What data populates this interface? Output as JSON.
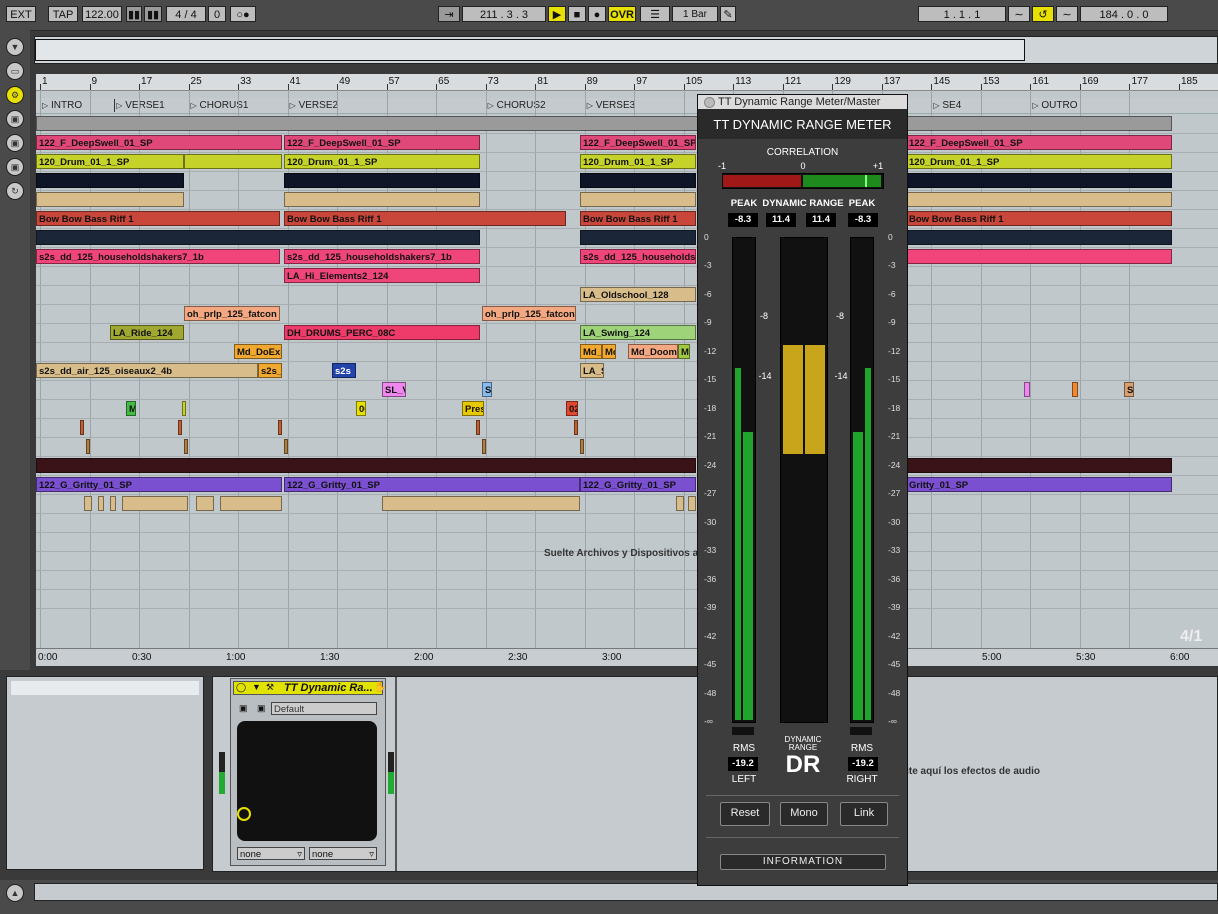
{
  "transport": {
    "ext": "EXT",
    "tap": "TAP",
    "tempo": "122.00",
    "signature_num": "4",
    "signature_sep": "/",
    "signature_den": "4",
    "metronome": "0",
    "position": "211 .  3 .  3",
    "ovr": "OVR",
    "quantize": "1 Bar",
    "loop_start": "1 .   1 .   1",
    "loop_length": "184 .   0 .   0"
  },
  "ruler": {
    "bars": [
      "1",
      "9",
      "17",
      "25",
      "33",
      "41",
      "49",
      "57",
      "65",
      "73",
      "81",
      "89",
      "97",
      "105",
      "113",
      "121",
      "129",
      "137",
      "145",
      "153",
      "161",
      "169",
      "177",
      "185"
    ]
  },
  "locators": [
    "INTRO",
    "VERSE1",
    "CHORUS1",
    "VERSE2",
    "CHORUS2",
    "VERSE3",
    "SE4",
    "OUTRO"
  ],
  "clips": {
    "deepswell": "122_F_DeepSwell_01_SP",
    "drum": "120_Drum_01_1_SP",
    "bass": "Bow Bow Bass Riff 1",
    "shakers": "s2s_dd_125_householdshakers7_1b",
    "shakers_short": "s2s_dd_125_householdsh",
    "hi_elements": "LA_Hi_Elements2_124",
    "oldschool": "LA_Oldschool_128",
    "fatcon": "oh_prlp_125_fatcon",
    "ride": "LA_Ride_124",
    "dh_drums": "DH_DRUMS_PERC_08C",
    "swing": "LA_Swing_124",
    "doexi": "Md_DoExi",
    "md": "Md_",
    "mo": "Mo",
    "doom": "Md_Doom",
    "m": "M",
    "oiseaux": "s2s_dd_air_125_oiseaux2_4b",
    "s2s_short": "s2s_",
    "s2s": "s2s",
    "la_s": "LA_S",
    "sl_v": "SL_V",
    "sl": "SL",
    "s": "S",
    "oo": "00",
    "pres": "Pres",
    "o2": "02",
    "gritty": "122_G_Gritty_01_SP",
    "gritty_short": "Gritty_01_SP"
  },
  "timeline": [
    "0:00",
    "0:30",
    "1:00",
    "1:30",
    "2:00",
    "2:30",
    "3:00",
    "5:00",
    "5:30",
    "6:00"
  ],
  "drop_files": "Suelte Archivos y Dispositivos ac",
  "drop_fx": "uite aquí los efectos de audio",
  "page_counter": "4/1",
  "device": {
    "name": "TT Dynamic Ra...",
    "preset": "Default",
    "dd1": "none",
    "dd2": "none"
  },
  "plugin": {
    "window_title": "TT Dynamic Range Meter/Master",
    "header": "TT DYNAMIC RANGE METER",
    "correlation_label": "CORRELATION",
    "corr_min": "-1",
    "corr_mid": "0",
    "corr_max": "+1",
    "peak_label": "PEAK",
    "dr_label": "DYNAMIC RANGE",
    "peak_left": "-8.3",
    "peak_right": "-8.3",
    "dr_left": "11.4",
    "dr_right": "11.4",
    "scale": [
      "0",
      "-3",
      "-6",
      "-9",
      "-12",
      "-15",
      "-18",
      "-21",
      "-24",
      "-27",
      "-30",
      "-33",
      "-36",
      "-39",
      "-42",
      "-45",
      "-48",
      "-∞"
    ],
    "marker_peak": "-8",
    "marker_rms": "-14",
    "rms_label": "RMS",
    "rms_left": "-19.2",
    "rms_right": "-19.2",
    "left_label": "LEFT",
    "right_label": "RIGHT",
    "dr_logo_small": "DYNAMIC RANGE",
    "dr_logo": "DR",
    "reset": "Reset",
    "mono": "Mono",
    "link": "Link",
    "information": "INFORMATION",
    "levels": {
      "peak": -8.3,
      "rms": -19.2,
      "dr_fill_db": -24.0,
      "min_db": -48
    }
  }
}
